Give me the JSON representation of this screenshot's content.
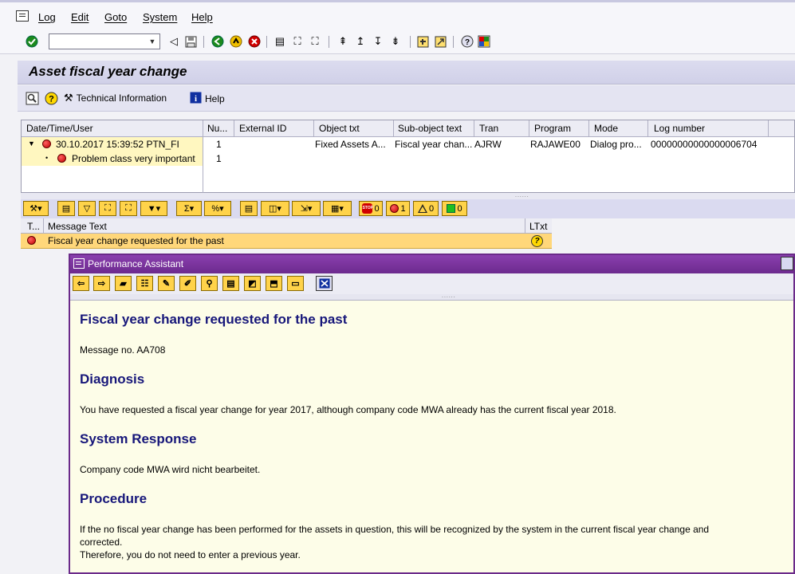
{
  "menu": {
    "items": [
      "Log",
      "Edit",
      "Goto",
      "System",
      "Help"
    ]
  },
  "toolbar": {
    "command_value": ""
  },
  "screen": {
    "title": "Asset fiscal year change",
    "tech_info_label": "Technical Information",
    "help_label": "Help"
  },
  "log_tree": {
    "columns": [
      "Date/Time/User",
      "Nu...",
      "External ID",
      "Object txt",
      "Sub-object text",
      "Tran",
      "Program",
      "Mode",
      "Log number"
    ],
    "row1": {
      "datetime_user": "30.10.2017  15:39:52  PTN_FI",
      "number": "1",
      "external_id": "",
      "object_txt": "Fixed Assets A...",
      "subobject_txt": "Fiscal year chan...",
      "tran": "AJRW",
      "program": "RAJAWE00",
      "mode": "Dialog pro...",
      "log_number": "00000000000000006704"
    },
    "row2": {
      "label": "Problem class very important",
      "number": "1"
    }
  },
  "alv_counts": {
    "stop": "0",
    "error": "1",
    "warning": "0",
    "success": "0"
  },
  "messages": {
    "col_type": "T...",
    "col_text": "Message Text",
    "col_ltxt": "LTxt",
    "rows": [
      {
        "text": "Fiscal year change requested for the past"
      }
    ]
  },
  "assistant": {
    "window_title": "Performance Assistant",
    "heading": "Fiscal year change requested for the past",
    "message_no": "Message no. AA708",
    "diagnosis_title": "Diagnosis",
    "diagnosis_text": "You have requested a fiscal year change for year 2017, although company code MWA already has the current fiscal year 2018.",
    "response_title": "System Response",
    "response_text": "Company code MWA wird nicht bearbeitet.",
    "procedure_title": "Procedure",
    "procedure_text1": "If the no fiscal year change has been performed for the assets in question, this will be recognized by the system in the current fiscal year change and",
    "procedure_text2": "corrected.",
    "procedure_text3": "Therefore, you do not need to enter a previous year."
  },
  "colors": {
    "title_bar": "#d0d0e8",
    "assistant_frame": "#6c2a8e",
    "heading_blue": "#17177a",
    "highlight_row": "#ffd77a"
  }
}
